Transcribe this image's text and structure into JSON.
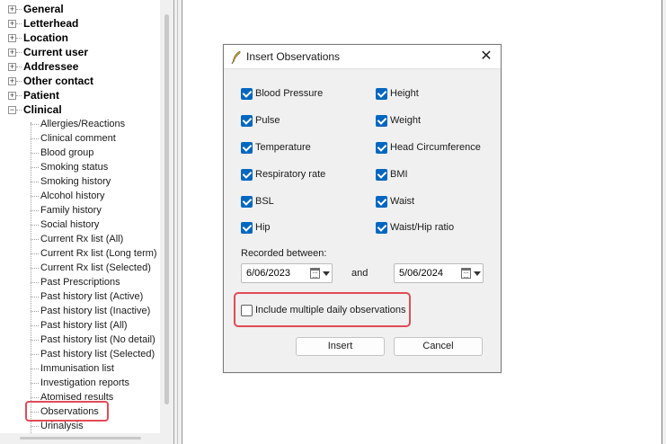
{
  "tree": {
    "top_items": [
      "General",
      "Letterhead",
      "Location",
      "Current user",
      "Addressee",
      "Other contact",
      "Patient",
      "Clinical"
    ],
    "expand_collapsed": "+",
    "expand_open": "−",
    "clinical_children": [
      "Allergies/Reactions",
      "Clinical comment",
      "Blood group",
      "Smoking status",
      "Smoking history",
      "Alcohol history",
      "Family history",
      "Social history",
      "Current Rx list (All)",
      "Current Rx list (Long term)",
      "Current Rx list (Selected)",
      "Past Prescriptions",
      "Past history list (Active)",
      "Past history list (Inactive)",
      "Past history list (All)",
      "Past history list (No detail)",
      "Past history list (Selected)",
      "Immunisation list",
      "Investigation reports",
      "Atomised results",
      "Observations",
      "Urinalysis"
    ]
  },
  "dialog": {
    "title": "Insert Observations",
    "close_glyph": "✕",
    "left_checks": [
      {
        "label": "Blood Pressure",
        "checked": true
      },
      {
        "label": "Pulse",
        "checked": true
      },
      {
        "label": "Temperature",
        "checked": true
      },
      {
        "label": "Respiratory rate",
        "checked": true
      },
      {
        "label": "BSL",
        "checked": true
      },
      {
        "label": "Hip",
        "checked": true
      }
    ],
    "right_checks": [
      {
        "label": "Height",
        "checked": true
      },
      {
        "label": "Weight",
        "checked": true
      },
      {
        "label": "Head Circumference",
        "checked": true
      },
      {
        "label": "BMI",
        "checked": true
      },
      {
        "label": "Waist",
        "checked": true
      },
      {
        "label": "Waist/Hip ratio",
        "checked": true
      }
    ],
    "recorded_between_label": "Recorded between:",
    "date_from": "6/06/2023",
    "and_label": "and",
    "date_to": "5/06/2024",
    "include_multiple_label": "Include multiple daily observations",
    "include_multiple_checked": false,
    "insert_label": "Insert",
    "cancel_label": "Cancel"
  },
  "colors": {
    "checkbox_checked": "#0067c0",
    "highlight": "#e04b57",
    "title_icon": "#c8a24a"
  }
}
